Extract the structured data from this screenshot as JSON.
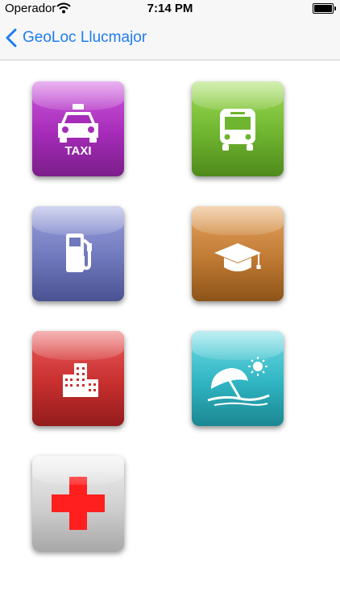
{
  "status_bar": {
    "carrier": "Operador",
    "time": "7:14 PM"
  },
  "nav": {
    "back_label": "GeoLoc Llucmajor"
  },
  "tiles": {
    "taxi": {
      "icon": "taxi-icon",
      "label": "TAXI",
      "color": "#a52bb8"
    },
    "bus": {
      "icon": "bus-icon",
      "color": "#6fb530"
    },
    "fuel": {
      "icon": "fuel-pump-icon",
      "color": "#6f78bc"
    },
    "education": {
      "icon": "graduation-cap-icon",
      "color": "#c07a34"
    },
    "city": {
      "icon": "building-icon",
      "color": "#c82f2f"
    },
    "beach": {
      "icon": "beach-umbrella-icon",
      "color": "#2fb4c2"
    },
    "health": {
      "icon": "red-cross-icon",
      "color": "#cfcfcf"
    }
  }
}
